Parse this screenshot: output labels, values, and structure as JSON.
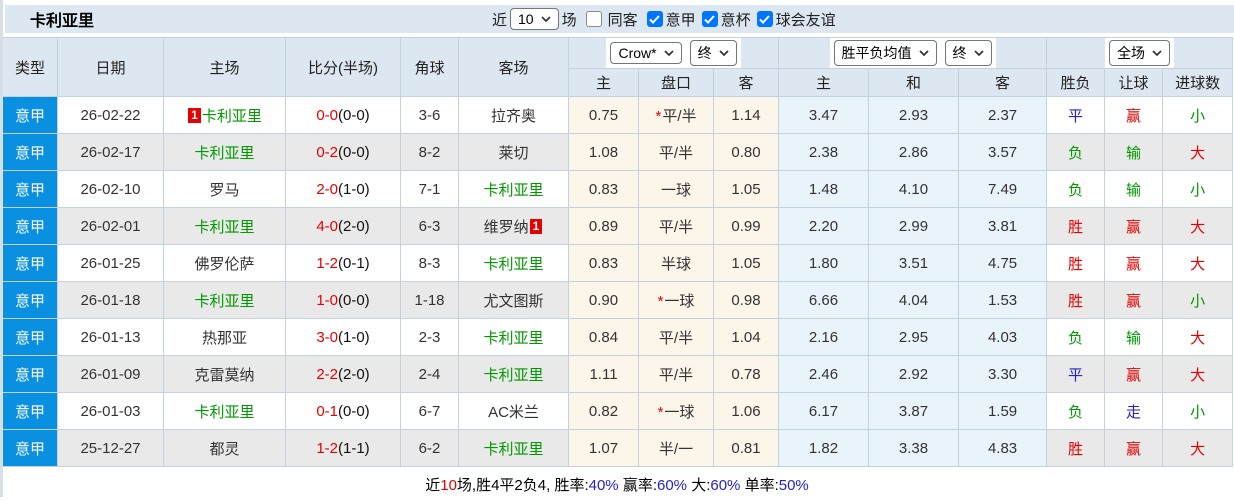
{
  "title": "卡利亚里",
  "controls": {
    "recent_label": "近",
    "recent_value": "10",
    "games_label": "场",
    "filters": [
      {
        "label": "同客",
        "checked": false
      },
      {
        "label": "意甲",
        "checked": true
      },
      {
        "label": "意杯",
        "checked": true
      },
      {
        "label": "球会友谊",
        "checked": true
      }
    ]
  },
  "header": {
    "columns": [
      "类型",
      "日期",
      "主场",
      "比分(半场)",
      "角球",
      "客场"
    ],
    "groups": [
      {
        "selects": [
          "Crow*",
          "终"
        ],
        "subs": [
          "主",
          "盘口",
          "客"
        ]
      },
      {
        "selects": [
          "胜平负均值",
          "终"
        ],
        "subs": [
          "主",
          "和",
          "客"
        ]
      },
      {
        "selects": [
          "全场"
        ],
        "subs": [
          "胜负",
          "让球",
          "进球数"
        ]
      }
    ]
  },
  "symbols": {
    "handicap_star": "*"
  },
  "rows": [
    {
      "league": "意甲",
      "date": "26-02-22",
      "home": "卡利亚里",
      "home_green": true,
      "home_badge": "1",
      "ft": "0-0",
      "ht": "(0-0)",
      "corners": "3-6",
      "away": "拉齐奥",
      "away_green": false,
      "away_badge": "",
      "oh": "0.75",
      "star": true,
      "hc": "平/半",
      "oa": "1.14",
      "aw": "3.47",
      "ad": "2.93",
      "al": "2.37",
      "res": "平",
      "res_c": "blue",
      "cov": "赢",
      "cov_c": "red",
      "gl": "小",
      "gl_c": "green"
    },
    {
      "league": "意甲",
      "date": "26-02-17",
      "home": "卡利亚里",
      "home_green": true,
      "home_badge": "",
      "ft": "0-2",
      "ht": "(0-0)",
      "corners": "8-2",
      "away": "莱切",
      "away_green": false,
      "away_badge": "",
      "oh": "1.08",
      "star": false,
      "hc": "平/半",
      "oa": "0.80",
      "aw": "2.38",
      "ad": "2.86",
      "al": "3.57",
      "res": "负",
      "res_c": "green",
      "cov": "输",
      "cov_c": "green",
      "gl": "大",
      "gl_c": "red"
    },
    {
      "league": "意甲",
      "date": "26-02-10",
      "home": "罗马",
      "home_green": false,
      "home_badge": "",
      "ft": "2-0",
      "ht": "(1-0)",
      "corners": "7-1",
      "away": "卡利亚里",
      "away_green": true,
      "away_badge": "",
      "oh": "0.83",
      "star": false,
      "hc": "一球",
      "oa": "1.05",
      "aw": "1.48",
      "ad": "4.10",
      "al": "7.49",
      "res": "负",
      "res_c": "green",
      "cov": "输",
      "cov_c": "green",
      "gl": "小",
      "gl_c": "green"
    },
    {
      "league": "意甲",
      "date": "26-02-01",
      "home": "卡利亚里",
      "home_green": true,
      "home_badge": "",
      "ft": "4-0",
      "ht": "(2-0)",
      "corners": "6-3",
      "away": "维罗纳",
      "away_green": false,
      "away_badge": "1",
      "oh": "0.89",
      "star": false,
      "hc": "平/半",
      "oa": "0.99",
      "aw": "2.20",
      "ad": "2.99",
      "al": "3.81",
      "res": "胜",
      "res_c": "red",
      "cov": "赢",
      "cov_c": "red",
      "gl": "大",
      "gl_c": "red"
    },
    {
      "league": "意甲",
      "date": "26-01-25",
      "home": "佛罗伦萨",
      "home_green": false,
      "home_badge": "",
      "ft": "1-2",
      "ht": "(0-1)",
      "corners": "8-3",
      "away": "卡利亚里",
      "away_green": true,
      "away_badge": "",
      "oh": "0.83",
      "star": false,
      "hc": "半球",
      "oa": "1.05",
      "aw": "1.80",
      "ad": "3.51",
      "al": "4.75",
      "res": "胜",
      "res_c": "red",
      "cov": "赢",
      "cov_c": "red",
      "gl": "大",
      "gl_c": "red"
    },
    {
      "league": "意甲",
      "date": "26-01-18",
      "home": "卡利亚里",
      "home_green": true,
      "home_badge": "",
      "ft": "1-0",
      "ht": "(0-0)",
      "corners": "1-18",
      "away": "尤文图斯",
      "away_green": false,
      "away_badge": "",
      "oh": "0.90",
      "star": true,
      "hc": "一球",
      "oa": "0.98",
      "aw": "6.66",
      "ad": "4.04",
      "al": "1.53",
      "res": "胜",
      "res_c": "red",
      "cov": "赢",
      "cov_c": "red",
      "gl": "小",
      "gl_c": "green"
    },
    {
      "league": "意甲",
      "date": "26-01-13",
      "home": "热那亚",
      "home_green": false,
      "home_badge": "",
      "ft": "3-0",
      "ht": "(1-0)",
      "corners": "2-3",
      "away": "卡利亚里",
      "away_green": true,
      "away_badge": "",
      "oh": "0.84",
      "star": false,
      "hc": "平/半",
      "oa": "1.04",
      "aw": "2.16",
      "ad": "2.95",
      "al": "4.03",
      "res": "负",
      "res_c": "green",
      "cov": "输",
      "cov_c": "green",
      "gl": "大",
      "gl_c": "red"
    },
    {
      "league": "意甲",
      "date": "26-01-09",
      "home": "克雷莫纳",
      "home_green": false,
      "home_badge": "",
      "ft": "2-2",
      "ht": "(2-0)",
      "corners": "2-4",
      "away": "卡利亚里",
      "away_green": true,
      "away_badge": "",
      "oh": "1.11",
      "star": false,
      "hc": "平/半",
      "oa": "0.78",
      "aw": "2.46",
      "ad": "2.92",
      "al": "3.30",
      "res": "平",
      "res_c": "blue",
      "cov": "赢",
      "cov_c": "red",
      "gl": "大",
      "gl_c": "red"
    },
    {
      "league": "意甲",
      "date": "26-01-03",
      "home": "卡利亚里",
      "home_green": true,
      "home_badge": "",
      "ft": "0-1",
      "ht": "(0-0)",
      "corners": "6-7",
      "away": "AC米兰",
      "away_green": false,
      "away_badge": "",
      "oh": "0.82",
      "star": true,
      "hc": "一球",
      "oa": "1.06",
      "aw": "6.17",
      "ad": "3.87",
      "al": "1.59",
      "res": "负",
      "res_c": "green",
      "cov": "走",
      "cov_c": "blue",
      "gl": "小",
      "gl_c": "green"
    },
    {
      "league": "意甲",
      "date": "25-12-27",
      "home": "都灵",
      "home_green": false,
      "home_badge": "",
      "ft": "1-2",
      "ht": "(1-1)",
      "corners": "6-2",
      "away": "卡利亚里",
      "away_green": true,
      "away_badge": "",
      "oh": "1.07",
      "star": false,
      "hc": "半/一",
      "oa": "0.81",
      "aw": "1.82",
      "ad": "3.38",
      "al": "4.83",
      "res": "胜",
      "res_c": "red",
      "cov": "赢",
      "cov_c": "red",
      "gl": "大",
      "gl_c": "red"
    }
  ],
  "footer": {
    "segments": [
      {
        "text": "近",
        "color": "black"
      },
      {
        "text": "10",
        "color": "red"
      },
      {
        "text": "场,胜4平2负4, 胜率:",
        "color": "black"
      },
      {
        "text": "40%",
        "color": "blue"
      },
      {
        "text": " 赢率:",
        "color": "black"
      },
      {
        "text": "60%",
        "color": "blue"
      },
      {
        "text": " 大:",
        "color": "black"
      },
      {
        "text": "60%",
        "color": "blue"
      },
      {
        "text": " 单率:",
        "color": "black"
      },
      {
        "text": "50%",
        "color": "blue"
      }
    ]
  },
  "colors": {
    "league_badge_blue": "#0a90e0",
    "header_bg": "#dde7f1",
    "stripe_grey": "#e9e9e9",
    "odds_bg_cream": "#fcf5ea",
    "avg_bg_blue": "#e9f3fa",
    "win_red": "#e60000",
    "lose_green": "#009900",
    "draw_blue": "#2222cc",
    "footer_percent_blue": "#2222cc",
    "checkbox_blue": "#0075ff"
  }
}
